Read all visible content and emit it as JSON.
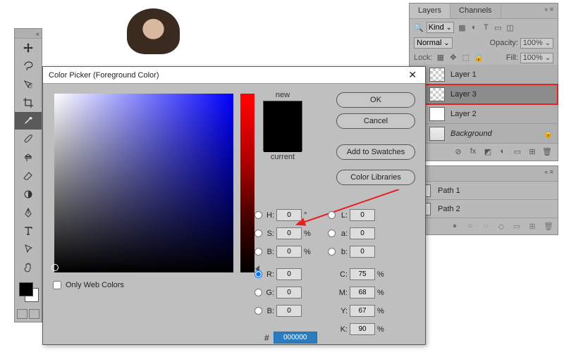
{
  "tools": {
    "items": [
      "move",
      "lasso",
      "magic-wand",
      "crop",
      "eyedropper",
      "brush",
      "clone",
      "eraser",
      "gradient",
      "pen",
      "text",
      "path-select",
      "hand"
    ]
  },
  "layers_panel": {
    "tabs": [
      "Layers",
      "Channels"
    ],
    "active_tab": 0,
    "kind_label": "Kind",
    "blend_mode": "Normal",
    "opacity_label": "Opacity:",
    "opacity_value": "100%",
    "lock_label": "Lock:",
    "fill_label": "Fill:",
    "fill_value": "100%",
    "layers": [
      {
        "name": "Layer 1",
        "visible": true,
        "thumb": "checker",
        "selected": false,
        "locked": false
      },
      {
        "name": "Layer 3",
        "visible": true,
        "thumb": "checker",
        "selected": true,
        "locked": false
      },
      {
        "name": "Layer 2",
        "visible": true,
        "thumb": "white",
        "selected": false,
        "locked": false
      },
      {
        "name": "Background",
        "visible": true,
        "thumb": "bg",
        "selected": false,
        "locked": true,
        "italic": true
      }
    ]
  },
  "paths_panel": {
    "items": [
      "Path 1",
      "Path 2"
    ]
  },
  "color_picker": {
    "title": "Color Picker (Foreground Color)",
    "new_label": "new",
    "current_label": "current",
    "buttons": {
      "ok": "OK",
      "cancel": "Cancel",
      "add_swatch": "Add to Swatches",
      "libraries": "Color Libraries"
    },
    "only_web": "Only Web Colors",
    "hsb": {
      "H": "0",
      "S": "0",
      "B": "0"
    },
    "rgb": {
      "R": "0",
      "G": "0",
      "B": "0"
    },
    "lab": {
      "L": "0",
      "a": "0",
      "b": "0"
    },
    "cmyk": {
      "C": "75",
      "M": "68",
      "Y": "67",
      "K": "90"
    },
    "hex_label": "#",
    "hex": "000000",
    "selected_model": "R"
  },
  "annotation_color": "#e62020"
}
